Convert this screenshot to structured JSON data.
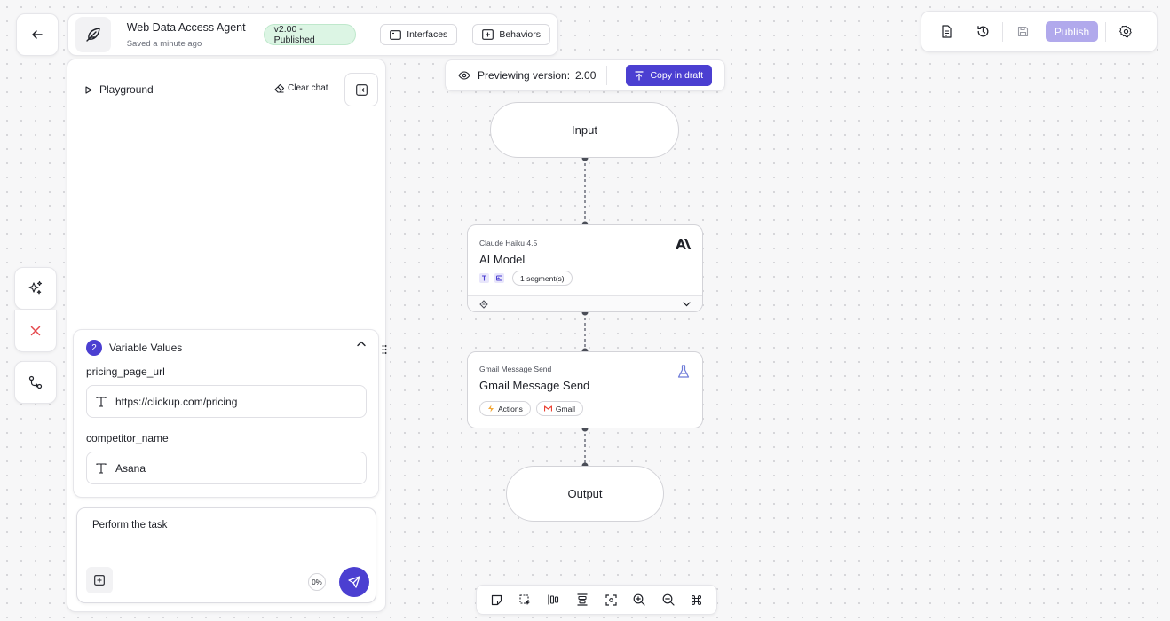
{
  "header": {
    "agent_name": "Web Data Access Agent",
    "saved_status": "Saved a minute ago",
    "version_badge": "v2.00 - Published",
    "interfaces_label": "Interfaces",
    "behaviors_label": "Behaviors"
  },
  "toolbar": {
    "publish_label": "Publish"
  },
  "preview": {
    "label": "Previewing version:",
    "version": "2.00",
    "copy_label": "Copy in draft"
  },
  "playground": {
    "title": "Playground",
    "clear_label": "Clear chat"
  },
  "variables": {
    "title": "Variable Values",
    "count": "2",
    "items": [
      {
        "name": "pricing_page_url",
        "value": "https://clickup.com/pricing"
      },
      {
        "name": "competitor_name",
        "value": "Asana"
      }
    ]
  },
  "chat": {
    "input_value": "Perform the task",
    "usage_percent": "0%"
  },
  "flow": {
    "input_label": "Input",
    "output_label": "Output",
    "ai_node": {
      "model": "Claude Haiku 4.5",
      "title": "AI Model",
      "segments": "1 segment(s)"
    },
    "gmail_node": {
      "subtitle": "Gmail Message Send",
      "title": "Gmail Message Send",
      "chip_actions": "Actions",
      "chip_gmail": "Gmail"
    }
  },
  "colors": {
    "accent": "#4b3fd1",
    "publish_disabled": "#b1a9ec",
    "published_badge_bg": "#dcf5e4",
    "danger": "#e5484d"
  }
}
